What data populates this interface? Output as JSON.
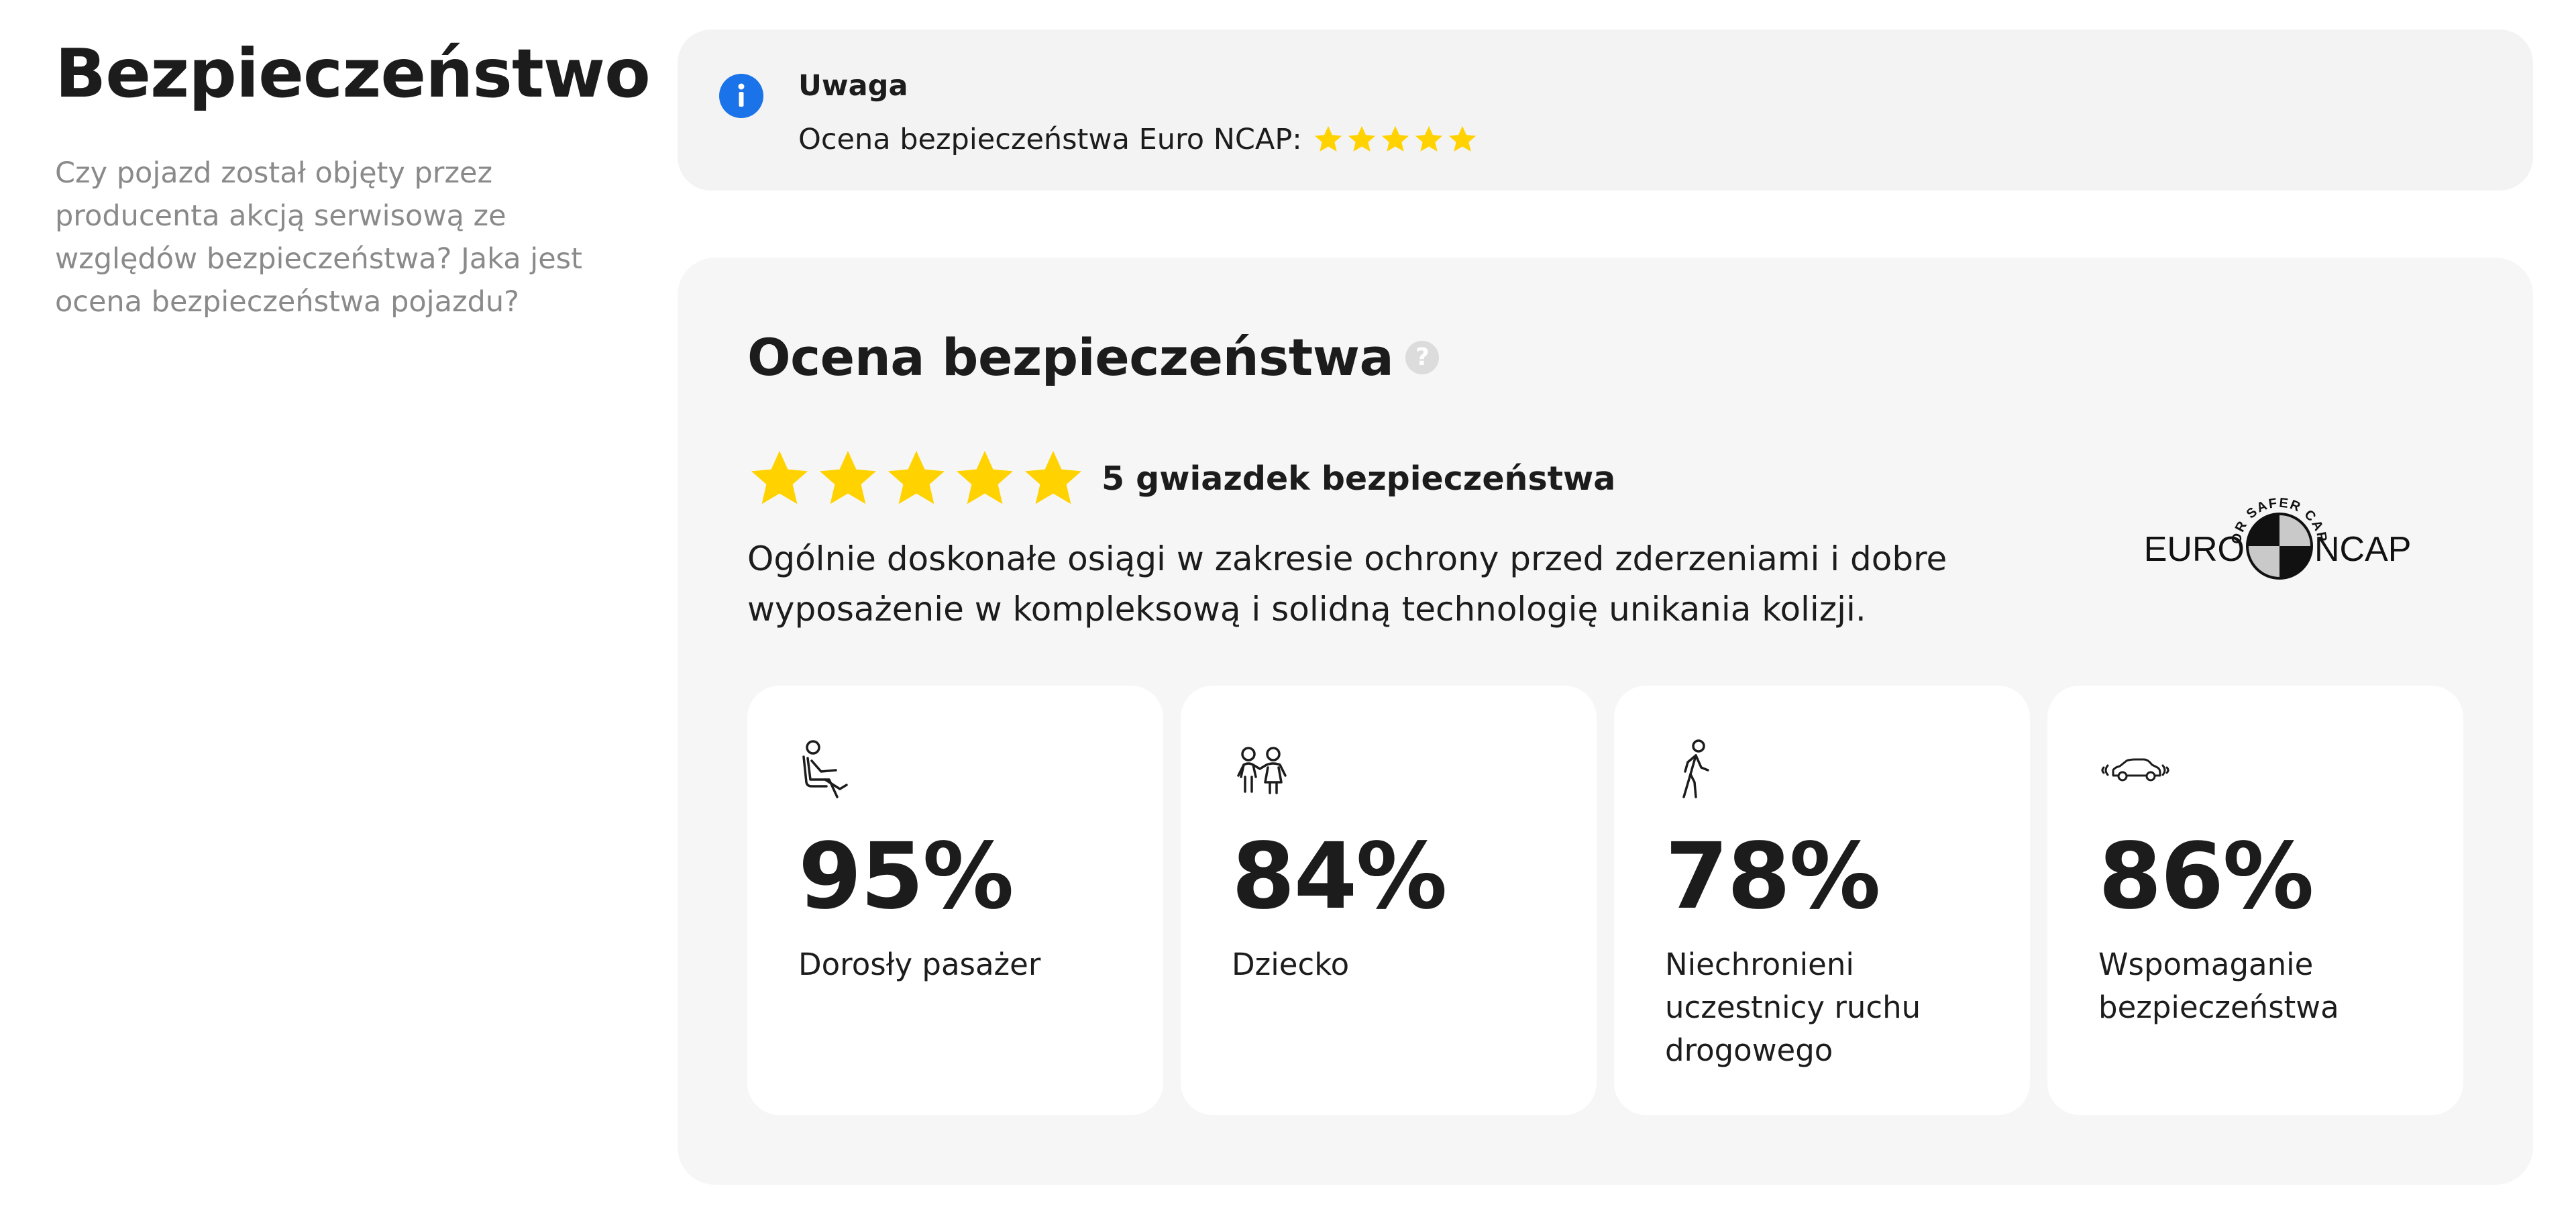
{
  "section": {
    "title": "Bezpieczeństwo",
    "description": "Czy pojazd został objęty przez producenta akcją serwisową ze względów bezpieczeństwa? Jaka jest ocena bezpieczeństwa pojazdu?"
  },
  "notice": {
    "icon": "info-icon",
    "title": "Uwaga",
    "text": "Ocena bezpieczeństwa Euro NCAP:",
    "stars": 5,
    "star_color": "#FFD200",
    "icon_color": "#1A73E8"
  },
  "rating": {
    "title": "Ocena bezpieczeństwa",
    "help_icon": "question-icon",
    "stars": 5,
    "stars_label": "5 gwiazdek bezpieczeństwa",
    "description": "Ogólnie doskonałe osiągi w zakresie ochrony przed zderzeniami i dobre wyposażenie w kompleksową i solidną technologię unikania kolizji.",
    "logo": {
      "top_text": "FOR SAFER CARS",
      "left_text": "EURO",
      "right_text": "NCAP"
    },
    "categories": [
      {
        "icon": "adult-seat-icon",
        "percent": "95%",
        "label": "Dorosły pasażer"
      },
      {
        "icon": "children-icon",
        "percent": "84%",
        "label": "Dziecko"
      },
      {
        "icon": "pedestrian-icon",
        "percent": "78%",
        "label": "Niechronieni uczestnicy ruchu drogowego"
      },
      {
        "icon": "car-sensor-icon",
        "percent": "86%",
        "label": "Wspomaganie bezpieczeństwa"
      }
    ]
  }
}
